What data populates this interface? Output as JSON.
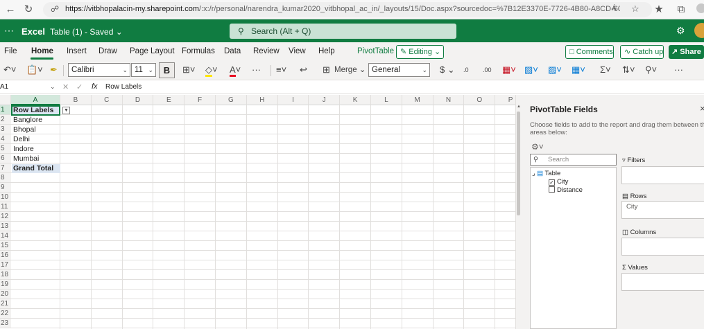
{
  "browser": {
    "url_host": "https://vitbhopalacin-my.sharepoint.com",
    "url_path": "/:x:/r/personal/narendra_kumar2020_vitbhopal_ac_in/_layouts/15/Doc.aspx?sourcedoc=%7B12E3370E-7726-4B80-A8CD-60BD334A84B6%...",
    "read_aloud": "Á"
  },
  "app": {
    "name": "Excel",
    "doc_title": "Table (1) - Saved",
    "search_placeholder": "Search (Alt + Q)"
  },
  "menu": {
    "tabs": [
      "File",
      "Home",
      "Insert",
      "Draw",
      "Page Layout",
      "Formulas",
      "Data",
      "Review",
      "View",
      "Help",
      "PivotTable"
    ],
    "editing": "Editing",
    "comments": "Comments",
    "catchup": "Catch up",
    "share": "Share"
  },
  "toolbar": {
    "font_name": "Calibri",
    "font_size": "11",
    "bold": "B",
    "merge": "Merge",
    "number_format": "General",
    "currency": "$",
    "dec_inc": ".0",
    "dec_dec": ".00",
    "more": "···"
  },
  "formula_bar": {
    "name_box": "A1",
    "fx": "fx",
    "content": "Row Labels"
  },
  "grid": {
    "columns": [
      "A",
      "B",
      "C",
      "D",
      "E",
      "F",
      "G",
      "H",
      "I",
      "J",
      "K",
      "L",
      "M",
      "N",
      "O",
      "P"
    ],
    "rows": [
      "1",
      "2",
      "3",
      "4",
      "5",
      "6",
      "7",
      "8",
      "9",
      "10",
      "11",
      "12",
      "13",
      "14",
      "15",
      "16",
      "17",
      "18",
      "19",
      "20",
      "21",
      "22",
      "23"
    ],
    "cells": {
      "a1": "Row Labels",
      "a2": "Banglore",
      "a3": "Bhopal",
      "a4": "Delhi",
      "a5": "Indore",
      "a6": "Mumbai",
      "a7": "Grand Total"
    }
  },
  "pivot_pane": {
    "title": "PivotTable Fields",
    "close": "×",
    "description": "Choose fields to add to the report and drag them between the areas below:",
    "search_placeholder": "Search",
    "table_name": "Table",
    "fields": [
      {
        "name": "City",
        "checked": true
      },
      {
        "name": "Distance",
        "checked": false
      }
    ],
    "areas": {
      "filters": "Filters",
      "rows": "Rows",
      "rows_value": "City",
      "columns": "Columns",
      "values": "Values"
    }
  }
}
